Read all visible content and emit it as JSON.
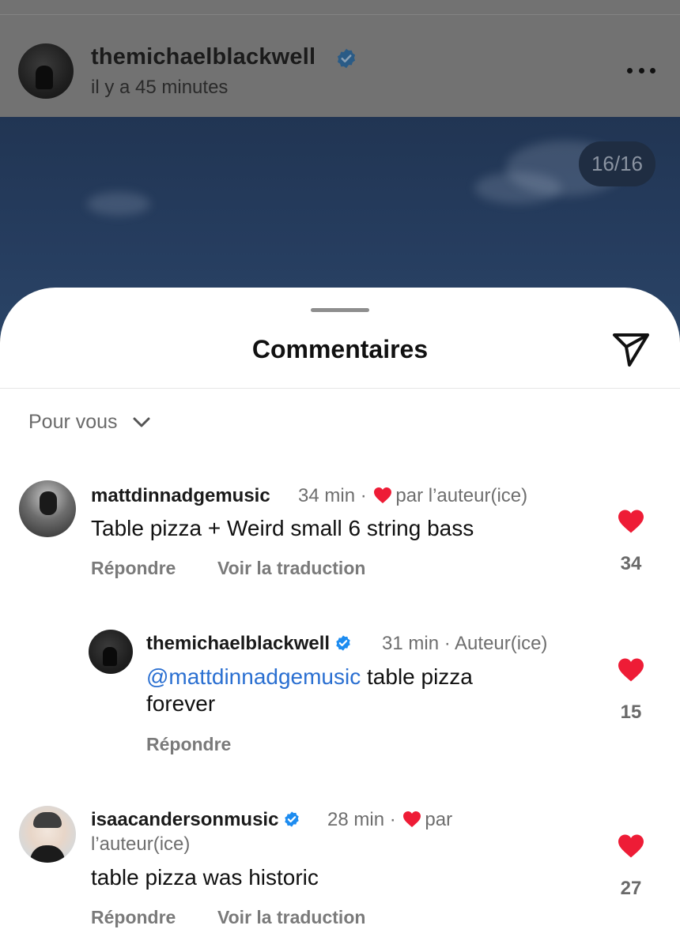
{
  "post": {
    "username": "themichaelblackwell",
    "time": "il y a 45 minutes",
    "counter": "16/16"
  },
  "sheet": {
    "title": "Commentaires",
    "sort_label": "Pour vous"
  },
  "comments": [
    {
      "username": "mattdinnadgemusic",
      "meta_time": "34 min · ",
      "meta_suffix": "par l’auteur(ice)",
      "text": "Table pizza + Weird small 6 string bass",
      "reply_label": "Répondre",
      "translate_label": "Voir la traduction",
      "likes": "34"
    },
    {
      "username": "themichaelblackwell",
      "meta_time": "31 min · Auteur(ice)",
      "mention": "@mattdinnadgemusic",
      "text_after_mention": " table pizza",
      "text_line2": "forever",
      "reply_label": "Répondre",
      "likes": "15"
    },
    {
      "username": "isaacandersonmusic",
      "meta_time": "28 min · ",
      "meta_suffix": "par",
      "meta_line2": "l’auteur(ice)",
      "text": "table pizza was historic",
      "reply_label": "Répondre",
      "translate_label": "Voir la traduction",
      "likes": "27"
    }
  ],
  "colors": {
    "heart": "#ee1c36",
    "mention": "#2a6fd1",
    "verified": "#1d8cf0",
    "verified_dimmed": "#2a5b86"
  }
}
